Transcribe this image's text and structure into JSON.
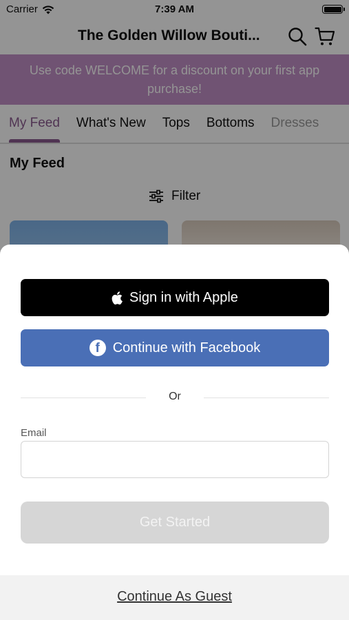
{
  "status_bar": {
    "carrier": "Carrier",
    "time": "7:39 AM",
    "icons": [
      "wifi-icon",
      "battery-icon"
    ]
  },
  "nav": {
    "title": "The Golden Willow Bouti...",
    "icons": [
      "search-icon",
      "cart-icon"
    ]
  },
  "promo_banner": {
    "text": "Use code WELCOME for a discount on your first app purchase!"
  },
  "tabs": [
    {
      "label": "My Feed",
      "active": true
    },
    {
      "label": "What's New",
      "active": false
    },
    {
      "label": "Tops",
      "active": false
    },
    {
      "label": "Bottoms",
      "active": false
    },
    {
      "label": "Dresses",
      "active": false
    }
  ],
  "feed": {
    "title": "My Feed",
    "filter_label": "Filter"
  },
  "login_sheet": {
    "apple_label": "Sign in with Apple",
    "facebook_label": "Continue with Facebook",
    "or_label": "Or",
    "email_label": "Email",
    "email_value": "",
    "email_placeholder": "",
    "start_label": "Get Started",
    "guest_label": "Continue As Guest"
  },
  "colors": {
    "brand_purple": "#8b5a8f",
    "promo_bg": "#c28fc6",
    "facebook_blue": "#4a6fb6",
    "apple_black": "#000000",
    "disabled_gray": "#d6d6d6"
  }
}
